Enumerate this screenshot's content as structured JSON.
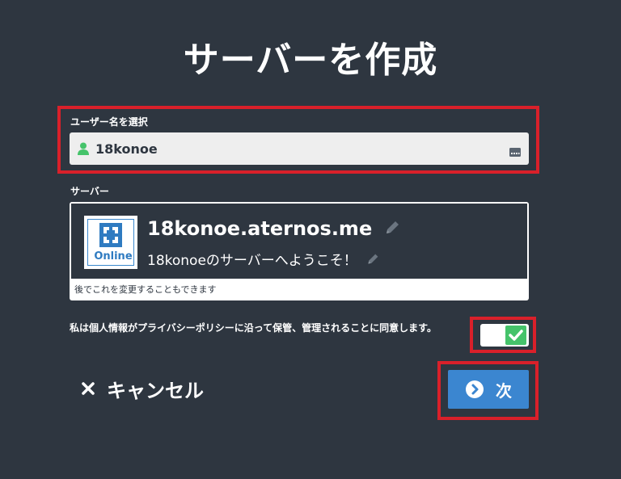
{
  "page": {
    "title": "サーバーを作成"
  },
  "username": {
    "label": "ユーザー名を選択",
    "value": "18konoe",
    "icon": "user-icon",
    "trailing_icon": "keyboard-icon"
  },
  "server": {
    "label": "サーバー",
    "status": "Online",
    "address": "18konoe.aternos.me",
    "motd": "18konoeのサーバーへようこそ！",
    "note": "後でこれを変更することもできます"
  },
  "consent": {
    "text": "私は個人情報がプライバシーポリシーに沿って保管、管理されることに同意します。",
    "checked": true
  },
  "actions": {
    "cancel_label": "キャンセル",
    "next_label": "次"
  },
  "colors": {
    "background": "#2e3640",
    "highlight": "#d9202a",
    "accent_blue": "#3b86d0",
    "toggle_green": "#45c36a",
    "user_icon_green": "#45c36a"
  }
}
